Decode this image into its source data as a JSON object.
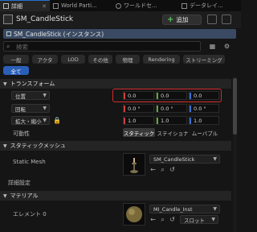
{
  "tabs": [
    {
      "label": "詳細",
      "active": true
    },
    {
      "label": "World Parti..."
    },
    {
      "label": "ワールドセ..."
    },
    {
      "label": "データレイ..."
    }
  ],
  "header": {
    "actor_name": "SM_CandleStick",
    "add_label": "追加"
  },
  "component": {
    "label": "SM_CandleStick (インスタンス)"
  },
  "search": {
    "placeholder": "検索"
  },
  "filters": {
    "row1": [
      "一般",
      "アクタ",
      "LOD",
      "その他",
      "物理",
      "Rendering",
      "ストリーミング"
    ],
    "row2": [
      "全て"
    ]
  },
  "transform": {
    "section_label": "トランスフォーム",
    "location": {
      "label": "位置",
      "x": "0.0",
      "y": "0.0",
      "z": "0.0"
    },
    "rotation": {
      "label": "回転",
      "x": "0.0 °",
      "y": "0.0 °",
      "z": "0.0 °"
    },
    "scale": {
      "label": "拡大・縮小",
      "x": "1.0",
      "y": "1.0",
      "z": "1.0"
    },
    "mobility": {
      "label": "可動性",
      "options": [
        "スタティック",
        "ステイショナ",
        "ムーバブル"
      ],
      "selected": "スタティック"
    }
  },
  "static_mesh_section": {
    "section_label": "スタティックメッシュ",
    "row_label": "Static Mesh",
    "value": "SM_CandleStick"
  },
  "advanced_label": "詳細設定",
  "materials": {
    "section_label": "マテリアル",
    "row_label": "エレメント 0",
    "value": "MI_Candle_Inst",
    "slot_label": "スロット"
  },
  "colors": {
    "accent": "#2a5fb8",
    "highlight_border": "#d42a2a",
    "x_axis": "#c94040",
    "y_axis": "#5fa83a",
    "z_axis": "#3a6fd0"
  }
}
